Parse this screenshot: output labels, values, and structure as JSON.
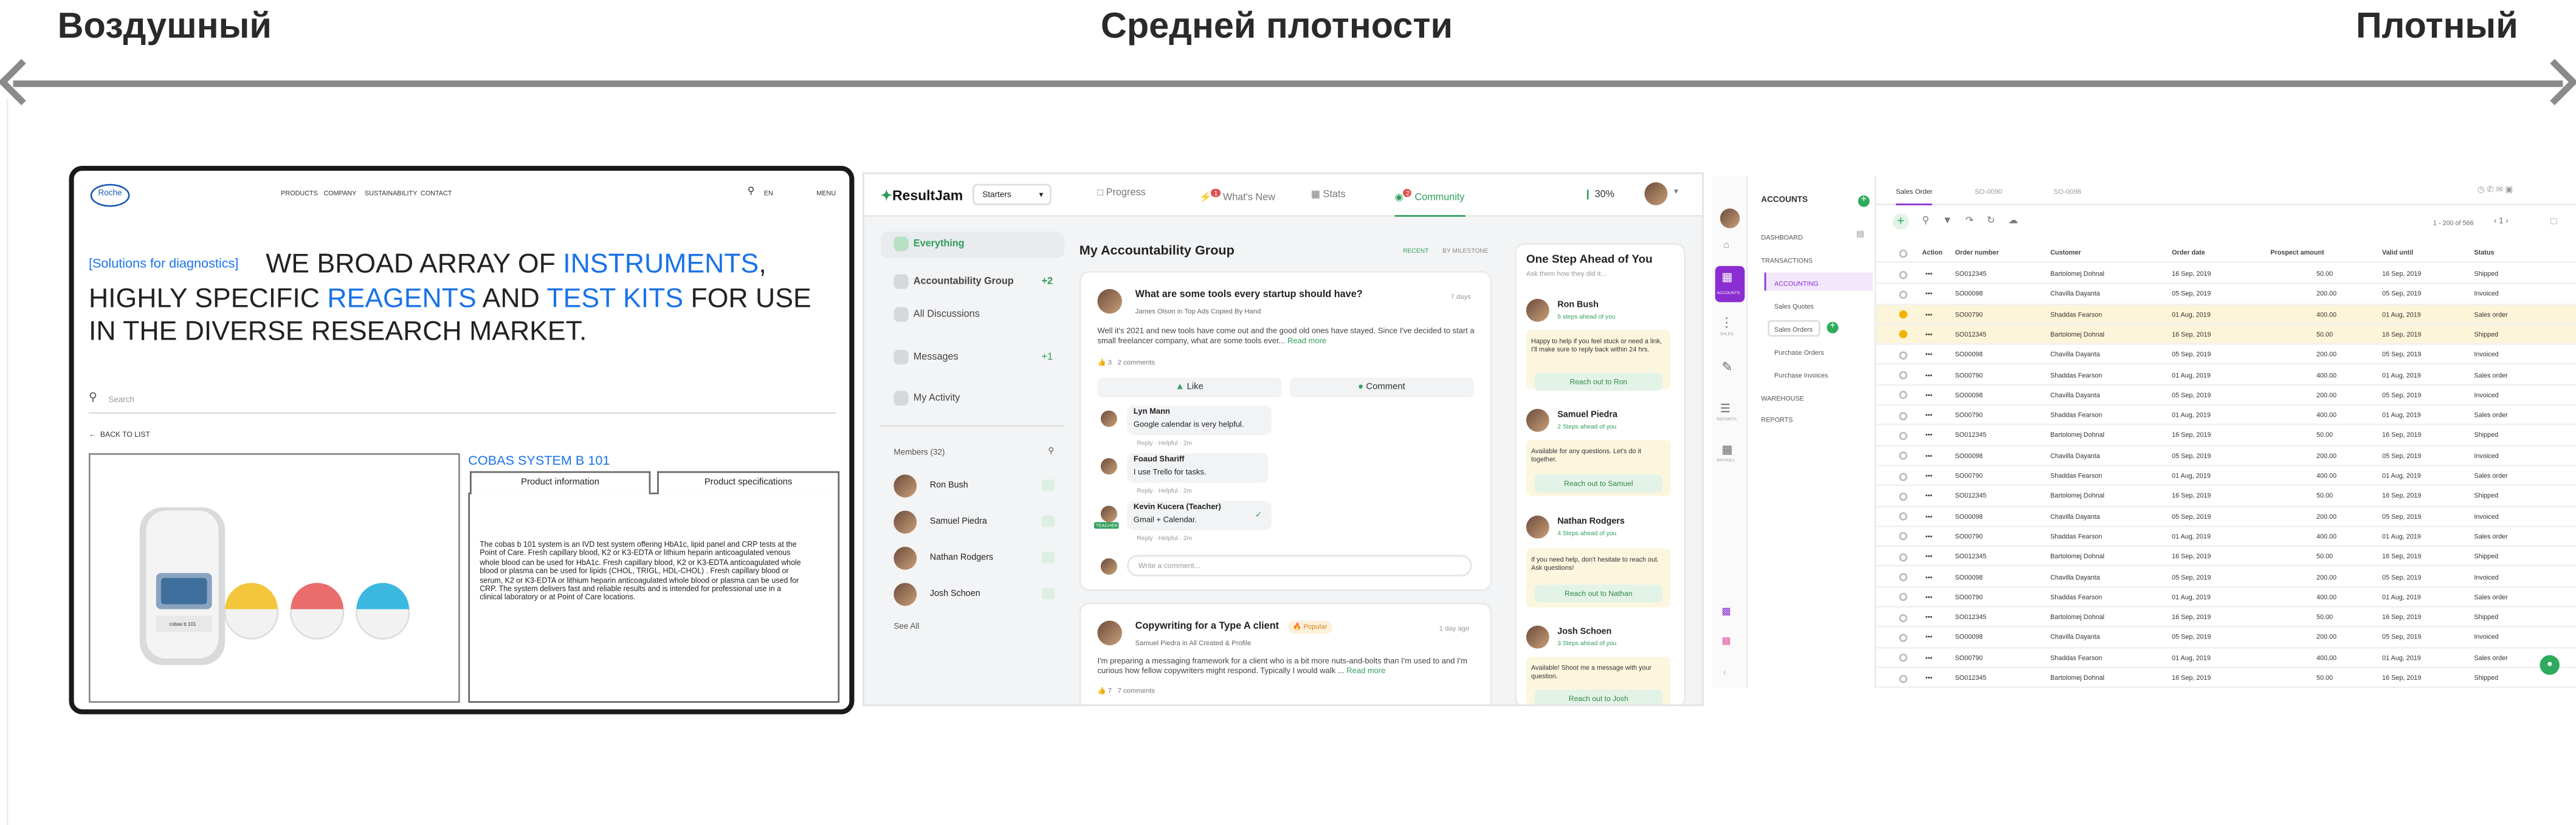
{
  "scale": {
    "left_label": "Воздушный",
    "middle_label": "Средней плотности",
    "right_label": "Плотный"
  },
  "panel1": {
    "logo": "Roche",
    "nav": [
      "PRODUCTS",
      "COMPANY",
      "SUSTAINABILITY",
      "CONTACT"
    ],
    "lang": "EN",
    "menu": "MENU",
    "hero_tag": "[Solutions for diagnostics]",
    "hero": {
      "p1": "WE BROAD ARRAY OF ",
      "instruments": "INSTRUMENTS",
      "p2": ", HIGHLY SPECIFIC ",
      "reagents": "REAGENTS",
      "p3": " AND ",
      "testkits": "TEST KITS",
      "p4": " FOR USE IN THE DIVERSE RESEARCH MARKET."
    },
    "search_placeholder": "Search",
    "back": "BACK TO LIST",
    "product_title": "COBAS SYSTEM B 101",
    "tab_info": "Product information",
    "tab_specs": "Product specifications",
    "device_label": "cobas b 101",
    "description": "The cobas b 101 system is an IVD test system offering HbA1c, lipid panel and CRP tests at the Point of Care. Fresh capillary blood, K2 or K3-EDTA or lithium heparin anticoagulated venous whole blood can be used for HbA1c. Fresh capillary blood, K2 or K3-EDTA anticoagulated whole blood or plasma can be used for lipids (CHOL, TRIGL, HDL-CHOL) . Fresh capillary blood or serum, K2 or K3-EDTA or lithium heparin anticoagulated whole blood or plasma can be used for CRP. The system delivers fast and reliable results and is intended for professional use in a clinical laboratory or at Point of Care locations."
  },
  "panel2": {
    "brand": "ResultJam",
    "workspace": "Starters",
    "tabs": [
      "Progress",
      "What's New",
      "Stats",
      "Community"
    ],
    "whats_new_badge": "1",
    "community_badge": "2",
    "progress_pct": "30%",
    "side": [
      "Everything",
      "Accountability Group",
      "All Discussions",
      "Messages",
      "My Activity"
    ],
    "side_badge_group": "+2",
    "side_badge_messages": "+1",
    "members_title": "Members (32)",
    "members": [
      "Ron Bush",
      "Samuel Piedra",
      "Nathan Rodgers",
      "Josh Schoen"
    ],
    "see_all": "See All",
    "feed_title": "My Accountability Group",
    "filter_recent": "RECENT",
    "filter_milestone": "BY MILESTONE",
    "post1": {
      "title": "What are some tools every startup should have?",
      "meta": "James Olson in Top Ads Copied By Hand",
      "time": "7 days",
      "body": "Well it's 2021 and new tools have come out and the good old ones have stayed. Since I've decided to start a small freelancer company, what are some tools ever...",
      "read_more": "Read more",
      "likes": "3",
      "comments": "2 comments",
      "like": "Like",
      "comment": "Comment"
    },
    "replies": [
      {
        "name": "Lyn Mann",
        "text": "Google calendar is very helpful.",
        "actions": "Reply · Helpful · 2m"
      },
      {
        "name": "Foaud Shariff",
        "text": "I use Trello for tasks.",
        "actions": "Reply · Helpful · 2m"
      },
      {
        "name": "Kevin Kucera (Teacher)",
        "text": "Gmail + Calendar.",
        "actions": "Reply · Helpful · 2m"
      }
    ],
    "teacher_badge": "TEACHER",
    "write_comment": "Write a comment...",
    "post2": {
      "title": "Copywriting for a Type A client",
      "badge": "Popular",
      "meta": "Samuel Piedra in All Created & Profile",
      "time": "1 day ago",
      "body": "I'm preparing a messaging framework for a client who is a bit more nuts-and-bolts than I'm used to and I'm curious how fellow copywriters might respond. Typically I would walk ...",
      "read_more": "Read more",
      "likes": "7",
      "comments": "7 comments"
    },
    "right_title": "One Step Ahead of You",
    "right_sub": "Ask them how they did it...",
    "ahead": [
      {
        "name": "Ron Bush",
        "steps": "5 steps ahead of you",
        "msg": "Happy to help if you feel stuck or need a link, I'll make sure to reply back within 24 hrs.",
        "cta": "Reach out to Ron"
      },
      {
        "name": "Samuel Piedra",
        "steps": "2 Steps ahead of you",
        "msg": "Available for any questions. Let's do it together.",
        "cta": "Reach out to Samuel"
      },
      {
        "name": "Nathan Rodgers",
        "steps": "4 Steps ahead of you",
        "msg": "If you need help, don't hesitate to reach out. Ask questions!",
        "cta": "Reach out to Nathan"
      },
      {
        "name": "Josh Schoen",
        "steps": "3 Steps ahead of you",
        "msg": "Available! Shoot me a message with your question.",
        "cta": "Reach out to Josh"
      }
    ]
  },
  "panel3": {
    "title": "ACCOUNTS",
    "tabs": [
      "Sales Order",
      "SO-0090",
      "SO-0098"
    ],
    "nav": [
      "DASHBOARD",
      "TRANSACTIONS",
      "ACCOUNTING",
      "Sales Quotes",
      "Sales Orders",
      "Purchase Orders",
      "Purchase Invoices",
      "WAREHOUSE",
      "REPORTS"
    ],
    "rail": [
      "ACCOUNTS",
      "SALES",
      "REPORTS",
      "PAYROLL"
    ],
    "paging": "1 - 200 of 566",
    "page": "1",
    "columns": [
      "Action",
      "Order number",
      "Customer",
      "Order date",
      "Prospect amount",
      "Valid until",
      "Status"
    ],
    "rows": [
      {
        "num": "SO012345",
        "cust": "Bartolomej Dohnal",
        "date": "16 Sep, 2019",
        "amt": "50.00",
        "valid": "16 Sep, 2019",
        "status": "Shipped",
        "sel": false
      },
      {
        "num": "SO00098",
        "cust": "Chavilla Dayanta",
        "date": "05 Sep, 2019",
        "amt": "200.00",
        "valid": "05 Sep, 2019",
        "status": "Invoiced",
        "sel": false
      },
      {
        "num": "SO00790",
        "cust": "Shaddas Fearson",
        "date": "01 Aug, 2019",
        "amt": "400.00",
        "valid": "01 Aug, 2019",
        "status": "Sales order",
        "sel": true
      },
      {
        "num": "SO012345",
        "cust": "Bartolomej Dohnal",
        "date": "16 Sep, 2019",
        "amt": "50.00",
        "valid": "16 Sep, 2019",
        "status": "Shipped",
        "sel": true
      },
      {
        "num": "SO00098",
        "cust": "Chavilla Dayanta",
        "date": "05 Sep, 2019",
        "amt": "200.00",
        "valid": "05 Sep, 2019",
        "status": "Invoiced",
        "sel": false
      },
      {
        "num": "SO00790",
        "cust": "Shaddas Fearson",
        "date": "01 Aug, 2019",
        "amt": "400.00",
        "valid": "01 Aug, 2019",
        "status": "Sales order",
        "sel": false
      },
      {
        "num": "SO00098",
        "cust": "Chavilla Dayanta",
        "date": "05 Sep, 2019",
        "amt": "200.00",
        "valid": "05 Sep, 2019",
        "status": "Invoiced",
        "sel": false
      },
      {
        "num": "SO00790",
        "cust": "Shaddas Fearson",
        "date": "01 Aug, 2019",
        "amt": "400.00",
        "valid": "01 Aug, 2019",
        "status": "Sales order",
        "sel": false
      },
      {
        "num": "SO012345",
        "cust": "Bartolomej Dohnal",
        "date": "16 Sep, 2019",
        "amt": "50.00",
        "valid": "16 Sep, 2019",
        "status": "Shipped",
        "sel": false
      },
      {
        "num": "SO00098",
        "cust": "Chavilla Dayanta",
        "date": "05 Sep, 2019",
        "amt": "200.00",
        "valid": "05 Sep, 2019",
        "status": "Invoiced",
        "sel": false
      },
      {
        "num": "SO00790",
        "cust": "Shaddas Fearson",
        "date": "01 Aug, 2019",
        "amt": "400.00",
        "valid": "01 Aug, 2019",
        "status": "Sales order",
        "sel": false
      },
      {
        "num": "SO012345",
        "cust": "Bartolomej Dohnal",
        "date": "16 Sep, 2019",
        "amt": "50.00",
        "valid": "16 Sep, 2019",
        "status": "Shipped",
        "sel": false
      },
      {
        "num": "SO00098",
        "cust": "Chavilla Dayanta",
        "date": "05 Sep, 2019",
        "amt": "200.00",
        "valid": "05 Sep, 2019",
        "status": "Invoiced",
        "sel": false
      },
      {
        "num": "SO00790",
        "cust": "Shaddas Fearson",
        "date": "01 Aug, 2019",
        "amt": "400.00",
        "valid": "01 Aug, 2019",
        "status": "Sales order",
        "sel": false
      },
      {
        "num": "SO012345",
        "cust": "Bartolomej Dohnal",
        "date": "16 Sep, 2019",
        "amt": "50.00",
        "valid": "16 Sep, 2019",
        "status": "Shipped",
        "sel": false
      },
      {
        "num": "SO00098",
        "cust": "Chavilla Dayanta",
        "date": "05 Sep, 2019",
        "amt": "200.00",
        "valid": "05 Sep, 2019",
        "status": "Invoiced",
        "sel": false
      },
      {
        "num": "SO00790",
        "cust": "Shaddas Fearson",
        "date": "01 Aug, 2019",
        "amt": "400.00",
        "valid": "01 Aug, 2019",
        "status": "Sales order",
        "sel": false
      },
      {
        "num": "SO012345",
        "cust": "Bartolomej Dohnal",
        "date": "16 Sep, 2019",
        "amt": "50.00",
        "valid": "16 Sep, 2019",
        "status": "Shipped",
        "sel": false
      },
      {
        "num": "SO00098",
        "cust": "Chavilla Dayanta",
        "date": "05 Sep, 2019",
        "amt": "200.00",
        "valid": "05 Sep, 2019",
        "status": "Invoiced",
        "sel": false
      },
      {
        "num": "SO00790",
        "cust": "Shaddas Fearson",
        "date": "01 Aug, 2019",
        "amt": "400.00",
        "valid": "01 Aug, 2019",
        "status": "Sales order",
        "sel": false
      },
      {
        "num": "SO012345",
        "cust": "Bartolomej Dohnal",
        "date": "16 Sep, 2019",
        "amt": "50.00",
        "valid": "16 Sep, 2019",
        "status": "Shipped",
        "sel": false
      },
      {
        "num": "SO012345",
        "cust": "Bartolomej Dohnal",
        "date": "16 Sep, 2019",
        "amt": "50.00",
        "valid": "16 Sep, 2019",
        "status": "Shipped",
        "sel": false
      }
    ]
  },
  "colors": {
    "accent_blue": "#1a73e8",
    "community_green": "#2f9e5b",
    "accent_purple": "#8b2ed1",
    "highlight": "#fdf5d9"
  }
}
